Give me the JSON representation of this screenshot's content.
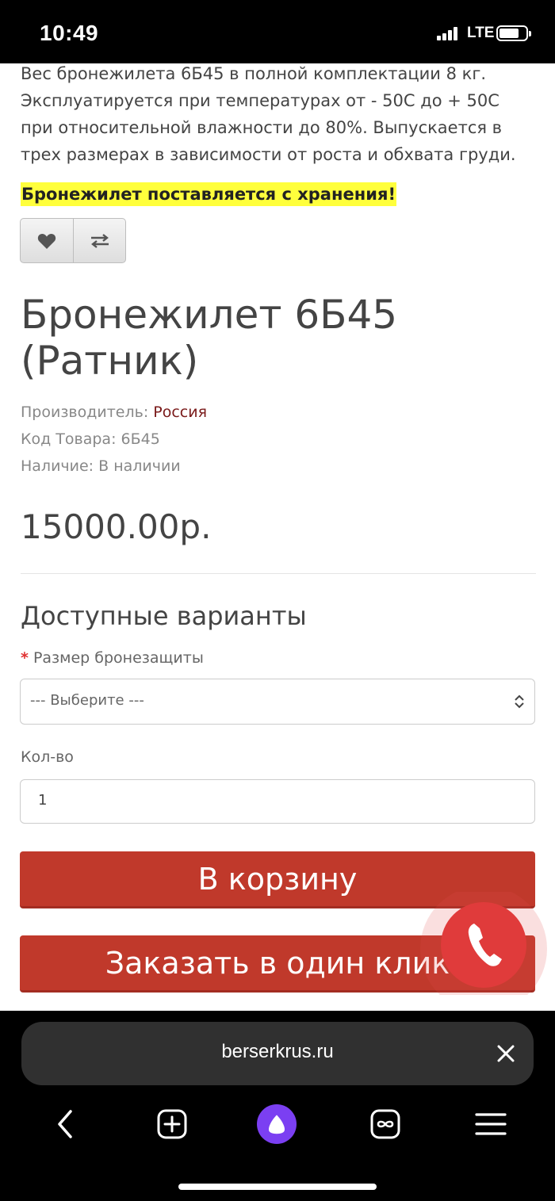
{
  "status_bar": {
    "time": "10:49",
    "network": "LTE"
  },
  "product": {
    "description": "Вес бронежилета 6Б45 в полной комплектации 8 кг. Эксплуатируется при температурах от - 50С до + 50С при относительной влажности до 80%. Выпускается в трех размерах в зависимости от роста и обхвата груди.",
    "notice": "Бронежилет поставляется с хранения!",
    "title": "Бронежилет 6Б45 (Ратник)",
    "manufacturer_label": "Производитель:",
    "manufacturer_value": "Россия",
    "code_label": "Код Товара:",
    "code_value": "6Б45",
    "availability_label": "Наличие:",
    "availability_value": "В наличии",
    "price": "15000.00р."
  },
  "options": {
    "title": "Доступные варианты",
    "size_label": "Размер бронезащиты",
    "required_mark": "*",
    "size_select_value": "--- Выберите ---",
    "qty_label": "Кол-во",
    "qty_value": "1"
  },
  "actions": {
    "add_to_cart": "В корзину",
    "one_click": "Заказать в один клик"
  },
  "browser": {
    "url": "berserkrus.ru"
  },
  "colors": {
    "accent_red": "#c0392b",
    "notice_highlight": "#ffff3c",
    "alice_purple": "#7b3ff2"
  }
}
